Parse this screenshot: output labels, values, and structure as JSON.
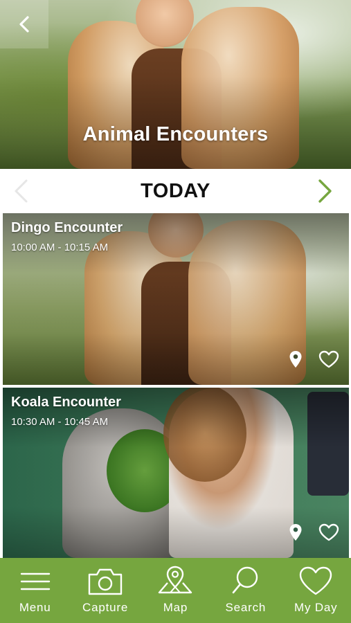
{
  "colors": {
    "brand_green": "#76a63f",
    "text_dark": "#111111",
    "arrow_disabled": "#e6e6e6"
  },
  "hero": {
    "title": "Animal Encounters",
    "back_icon": "chevron-left-icon"
  },
  "day_selector": {
    "label": "TODAY",
    "prev_icon": "chevron-left-icon",
    "next_icon": "chevron-right-icon"
  },
  "encounters": [
    {
      "title": "Dingo Encounter",
      "time": "10:00 AM - 10:15 AM",
      "location_icon": "map-pin-icon",
      "favorite_icon": "heart-outline-icon"
    },
    {
      "title": "Koala Encounter",
      "time": "10:30 AM - 10:45 AM",
      "location_icon": "map-pin-icon",
      "favorite_icon": "heart-outline-icon"
    }
  ],
  "tabs": [
    {
      "label": "Menu",
      "icon": "hamburger-icon"
    },
    {
      "label": "Capture",
      "icon": "camera-icon"
    },
    {
      "label": "Map",
      "icon": "map-pin-icon"
    },
    {
      "label": "Search",
      "icon": "search-icon"
    },
    {
      "label": "My Day",
      "icon": "heart-outline-icon"
    }
  ]
}
